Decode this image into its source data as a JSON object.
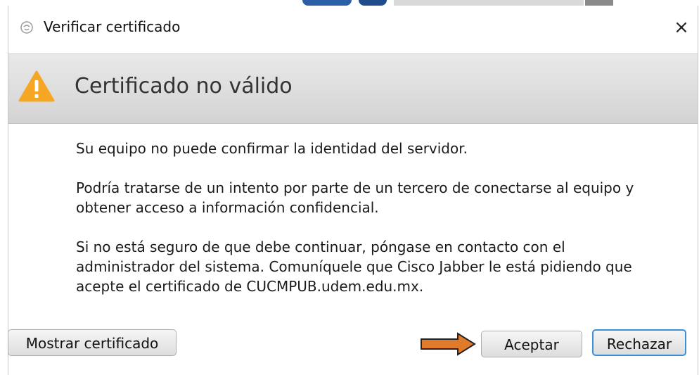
{
  "window": {
    "title": "Verificar certificado",
    "close_glyph": "×"
  },
  "header": {
    "icon": "warning-icon",
    "title": "Certificado no válido"
  },
  "message": {
    "paragraph1": "Su equipo no puede confirmar la identidad del servidor.",
    "paragraph2_line1": "Podría tratarse de un intento por parte de un tercero de conectarse al equipo y",
    "paragraph2_line2": "obtener acceso a información confidencial.",
    "paragraph3_line1": "Si no está seguro de que debe continuar, póngase en contacto con el",
    "paragraph3_line2": "administrador del sistema. Comuníquele que Cisco Jabber le está pidiendo que",
    "paragraph3_line3": "acepte el certificado de CUCMPUB.udem.edu.mx."
  },
  "buttons": {
    "show_certificate": "Mostrar certificado",
    "accept": "Aceptar",
    "reject": "Rechazar"
  },
  "colors": {
    "warning": "#f5a623",
    "arrow": "#e07b2b",
    "focus_border": "#3c8fd8"
  }
}
